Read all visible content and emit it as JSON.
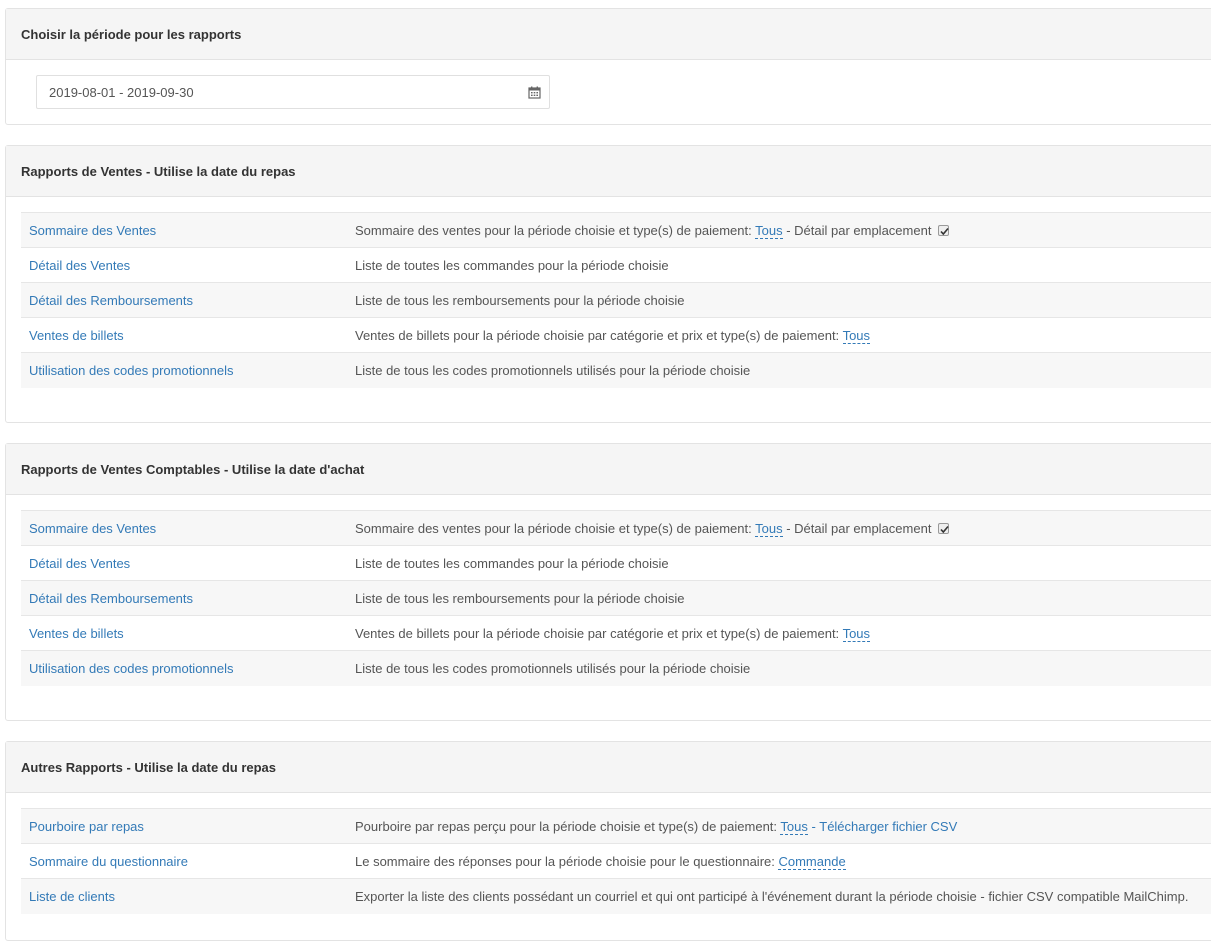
{
  "period": {
    "title": "Choisir la période pour les rapports",
    "date_range": "2019-08-01 - 2019-09-30"
  },
  "sales": {
    "title": "Rapports de Ventes - Utilise la date du repas",
    "rows": [
      {
        "link": "Sommaire des Ventes",
        "desc": "Sommaire des ventes pour la période choisie et type(s) de paiement:",
        "option": "Tous",
        "suffix": "- Détail par emplacement"
      },
      {
        "link": "Détail des Ventes",
        "desc": "Liste de toutes les commandes pour la période choisie"
      },
      {
        "link": "Détail des Remboursements",
        "desc": "Liste de tous les remboursements pour la période choisie"
      },
      {
        "link": "Ventes de billets",
        "desc": "Ventes de billets pour la période choisie par catégorie et prix et type(s) de paiement:",
        "option": "Tous"
      },
      {
        "link": "Utilisation des codes promotionnels",
        "desc": "Liste de tous les codes promotionnels utilisés pour la période choisie"
      }
    ]
  },
  "accounting": {
    "title": "Rapports de Ventes Comptables - Utilise la date d'achat",
    "rows": [
      {
        "link": "Sommaire des Ventes",
        "desc": "Sommaire des ventes pour la période choisie et type(s) de paiement:",
        "option": "Tous",
        "suffix": "- Détail par emplacement"
      },
      {
        "link": "Détail des Ventes",
        "desc": "Liste de toutes les commandes pour la période choisie"
      },
      {
        "link": "Détail des Remboursements",
        "desc": "Liste de tous les remboursements pour la période choisie"
      },
      {
        "link": "Ventes de billets",
        "desc": "Ventes de billets pour la période choisie par catégorie et prix et type(s) de paiement:",
        "option": "Tous"
      },
      {
        "link": "Utilisation des codes promotionnels",
        "desc": "Liste de tous les codes promotionnels utilisés pour la période choisie"
      }
    ]
  },
  "others": {
    "title": "Autres Rapports - Utilise la date du repas",
    "rows": [
      {
        "link": "Pourboire par repas",
        "desc": "Pourboire par repas perçu pour la période choisie et type(s) de paiement:",
        "option": "Tous",
        "sep": "-",
        "csv": "Télécharger fichier CSV"
      },
      {
        "link": "Sommaire du questionnaire",
        "desc": "Le sommaire des réponses pour la période choisie pour le questionnaire:",
        "option": "Commande"
      },
      {
        "link": "Liste de clients",
        "desc": "Exporter la liste des clients possédant un courriel et qui ont participé à l'événement durant la période choisie - fichier CSV compatible MailChimp."
      }
    ]
  }
}
